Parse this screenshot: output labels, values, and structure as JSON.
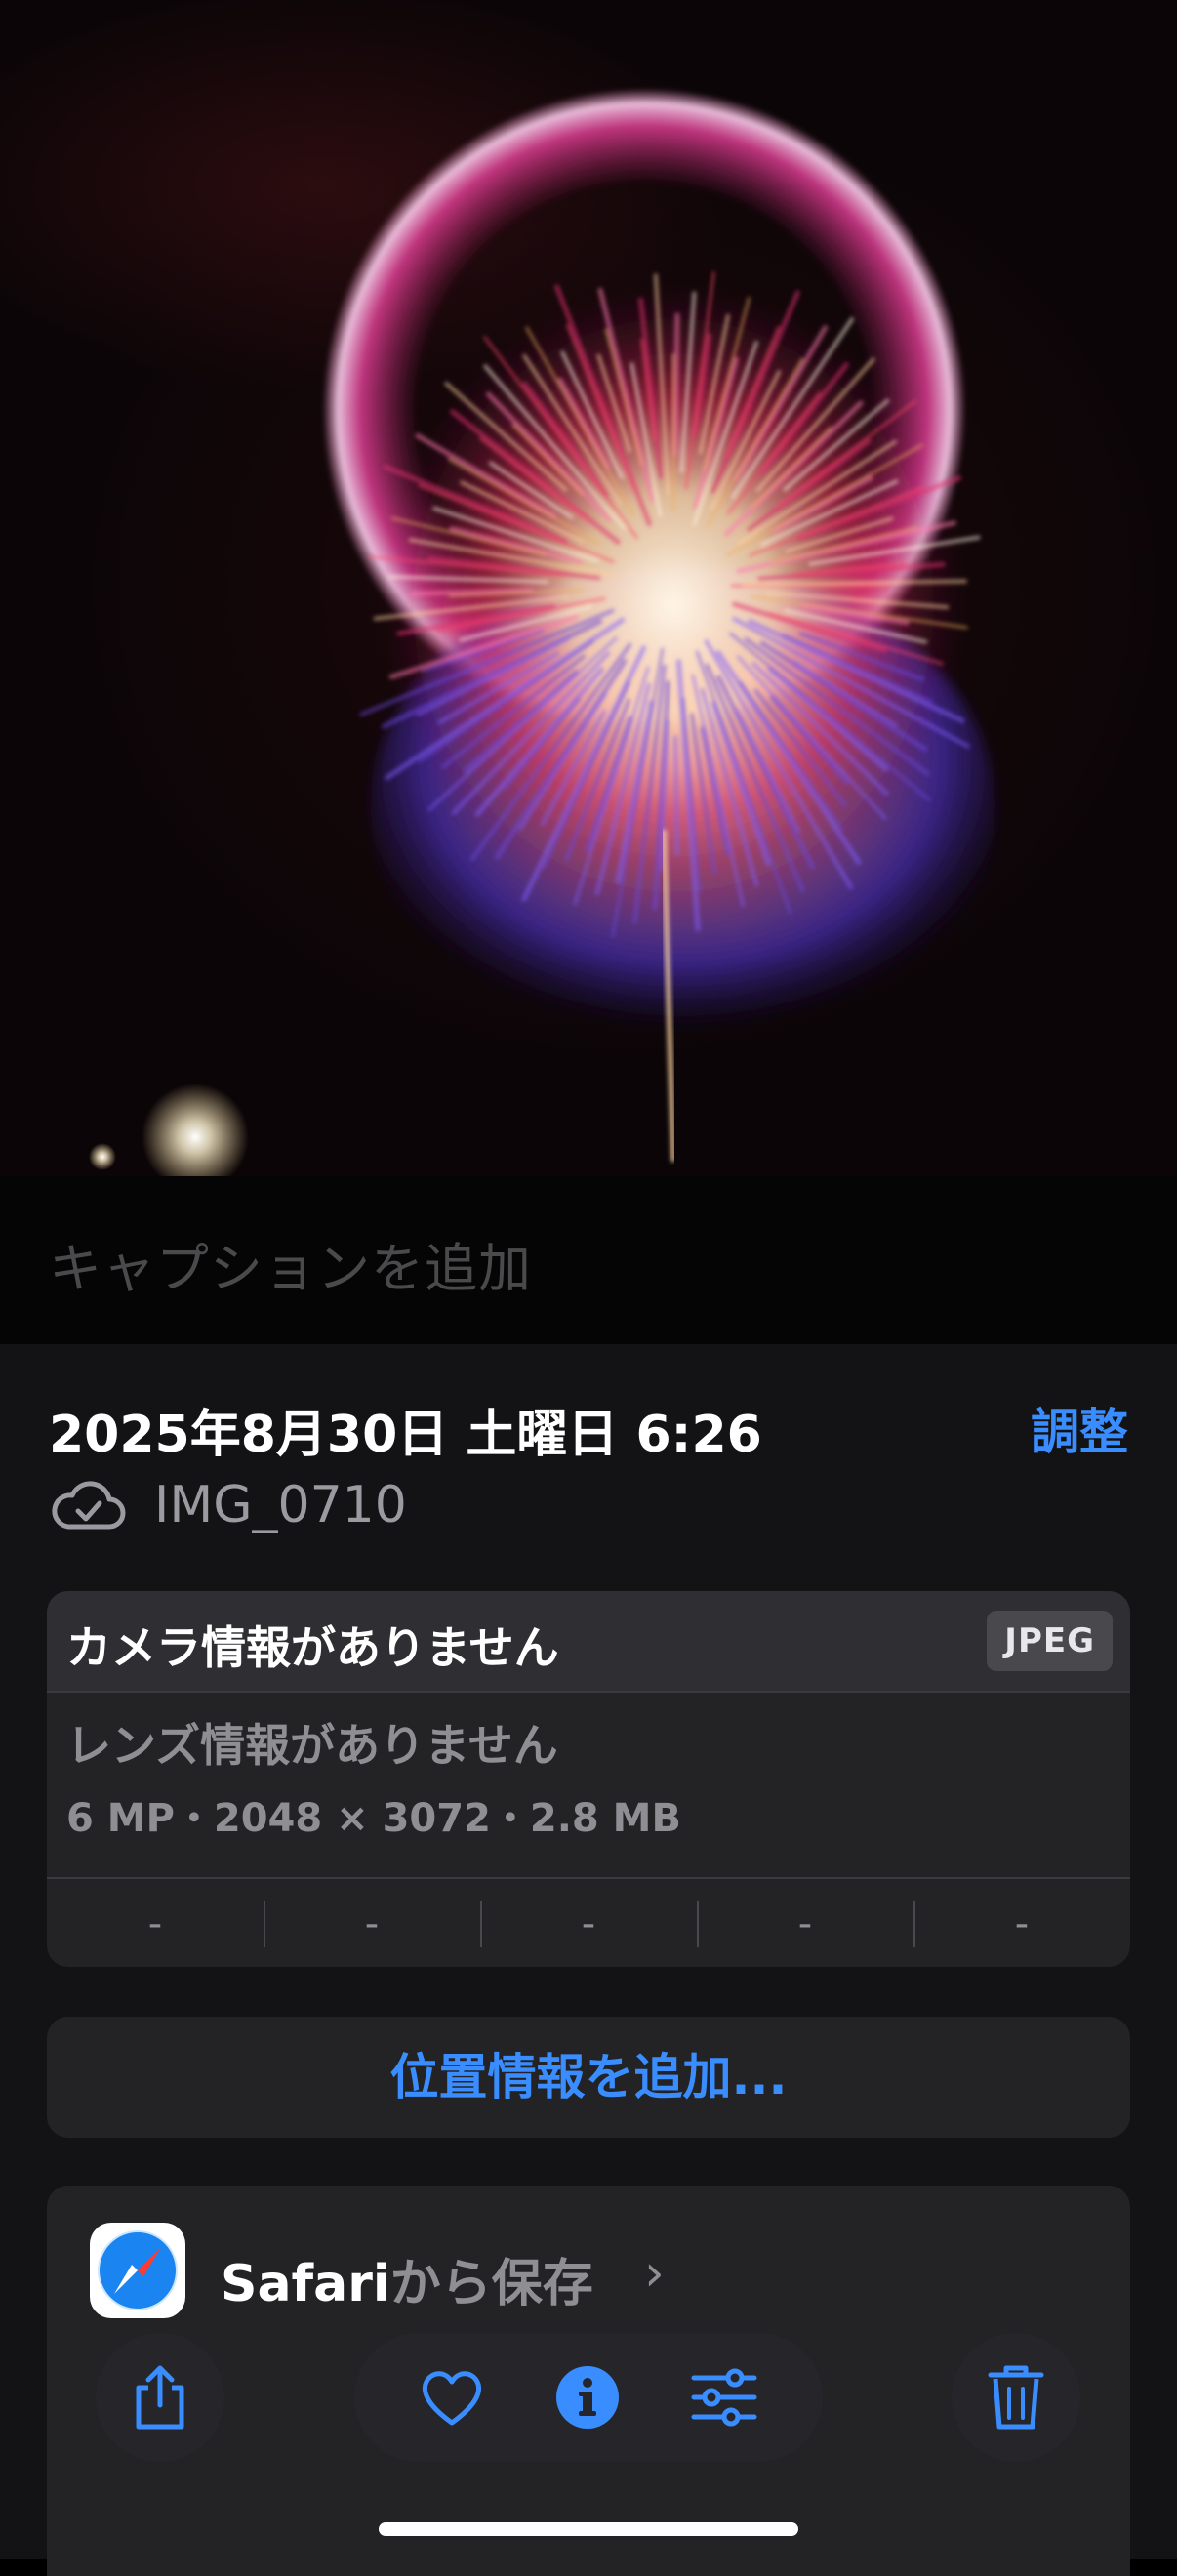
{
  "photo": {
    "caption_placeholder": "キャプションを追加"
  },
  "info": {
    "date_time": "2025年8月30日 土曜日 6:26",
    "adjust_label": "調整",
    "file_name": "IMG_0710",
    "camera_title": "カメラ情報がありません",
    "format_badge": "JPEG",
    "lens_text": "レンズ情報がありません",
    "specs": "6 MP・2048 × 3072・2.8 MB",
    "exif_values": [
      "-",
      "-",
      "-",
      "-",
      "-"
    ],
    "add_location_label": "位置情報を追加...",
    "source_app": "Safari",
    "source_suffix": "から保存"
  },
  "toolbar": {
    "share_icon": "share-icon",
    "favorite_icon": "heart-icon",
    "info_icon": "info-icon",
    "adjust_icon": "sliders-icon",
    "delete_icon": "trash-icon",
    "accent_color": "#3a8dff"
  }
}
